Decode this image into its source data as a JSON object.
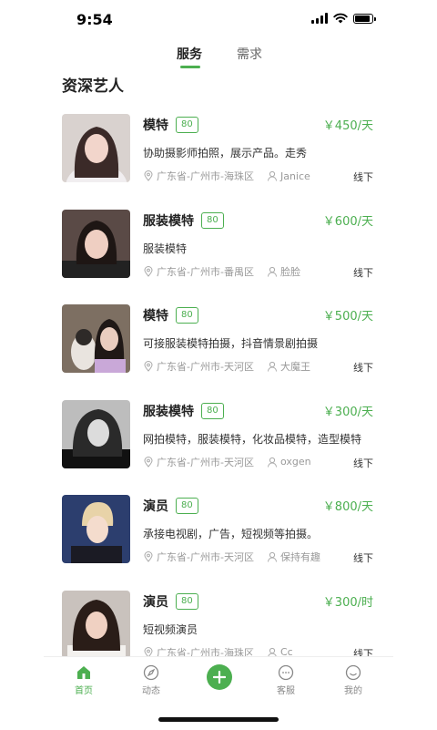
{
  "status_bar": {
    "time": "9:54"
  },
  "tabs": {
    "service": "服务",
    "demand": "需求"
  },
  "section_title": "资深艺人",
  "artists": [
    {
      "title": "模特",
      "score": "80",
      "price": "￥450/天",
      "desc": "协助摄影师拍照，展示产品。走秀",
      "location": "广东省-广州市-海珠区",
      "user": "Janice",
      "mode": "线下"
    },
    {
      "title": "服装模特",
      "score": "80",
      "price": "￥600/天",
      "desc": "服装模特",
      "location": "广东省-广州市-番禺区",
      "user": "脸脸",
      "mode": "线下"
    },
    {
      "title": "模特",
      "score": "80",
      "price": "￥500/天",
      "desc": "可接服装模特拍摄，抖音情景剧拍摄",
      "location": "广东省-广州市-天河区",
      "user": "大魔王",
      "mode": "线下"
    },
    {
      "title": "服装模特",
      "score": "80",
      "price": "￥300/天",
      "desc": "网拍模特，服装模特，化妆品模特，造型模特",
      "location": "广东省-广州市-天河区",
      "user": "oxgen",
      "mode": "线下"
    },
    {
      "title": "演员",
      "score": "80",
      "price": "￥800/天",
      "desc": "承接电视剧，广告，短视频等拍摄。",
      "location": "广东省-广州市-天河区",
      "user": "保持有趣",
      "mode": "线下"
    },
    {
      "title": "演员",
      "score": "80",
      "price": "￥300/时",
      "desc": "短视频演员",
      "location": "广东省-广州市-海珠区",
      "user": "Cc",
      "mode": "线下"
    }
  ],
  "nav": {
    "home": "首页",
    "feed": "动态",
    "service": "客服",
    "mine": "我的"
  },
  "colors": {
    "accent": "#4caf50"
  }
}
